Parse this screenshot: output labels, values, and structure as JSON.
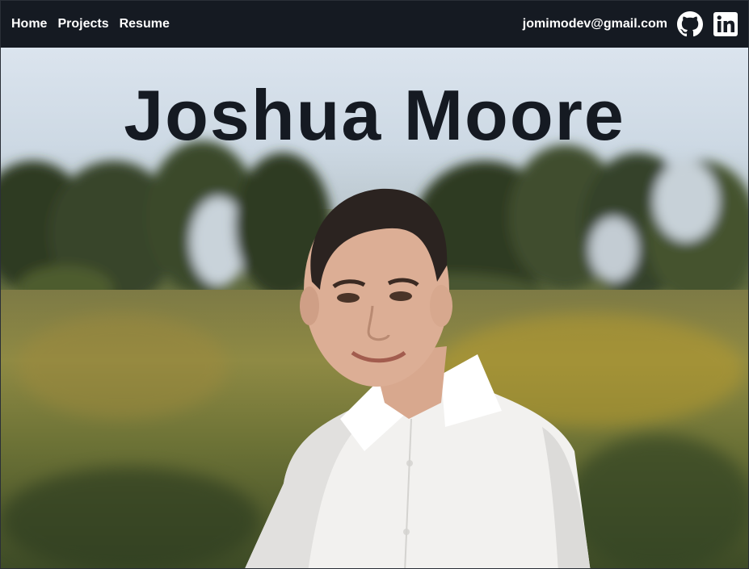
{
  "nav": {
    "links": [
      "Home",
      "Projects",
      "Resume"
    ],
    "email": "jomimodev@gmail.com",
    "icons": [
      "github-icon",
      "linkedin-icon"
    ]
  },
  "hero": {
    "title": "Joshua Moore",
    "photo_description": "portrait-photo"
  },
  "colors": {
    "navbar": "#151a22",
    "title": "#151a22",
    "nav_text": "#ffffff"
  }
}
